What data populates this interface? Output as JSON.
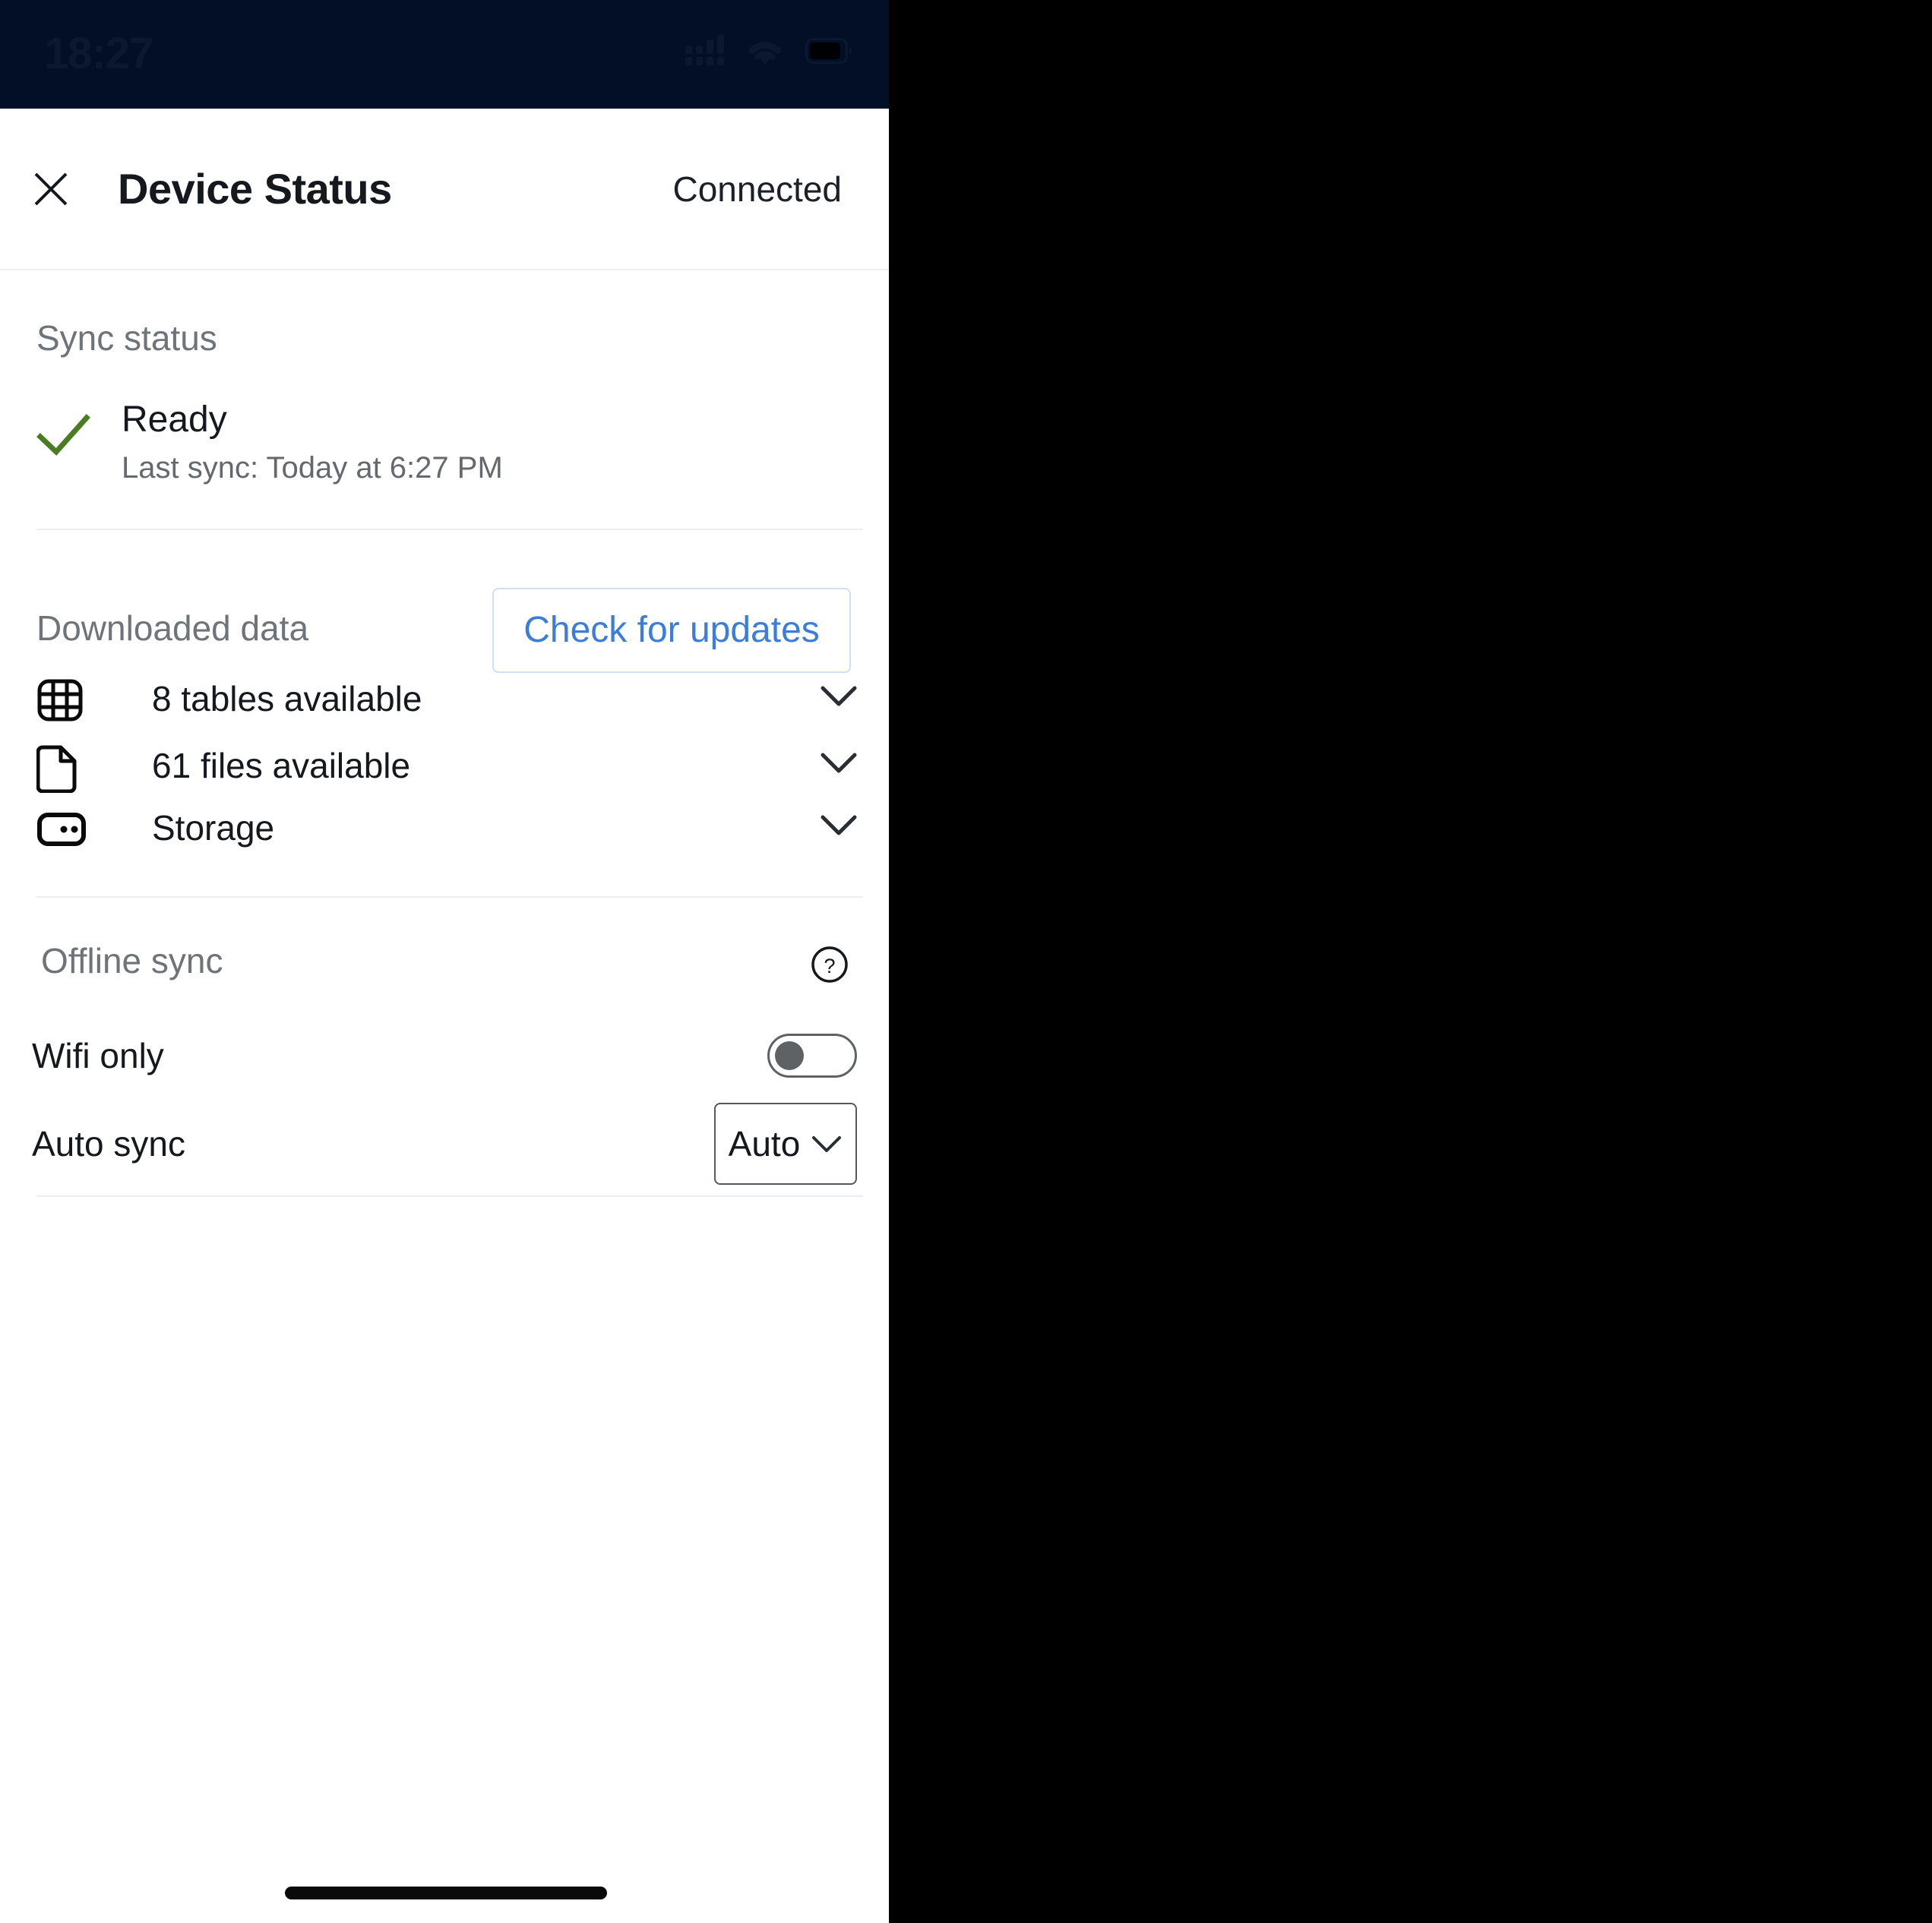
{
  "status_bar": {
    "time": "18:27",
    "icons": [
      "cellular-signal-icon",
      "wifi-icon",
      "battery-icon"
    ]
  },
  "header": {
    "close_icon": "close-icon",
    "title": "Device Status",
    "connection_status": "Connected"
  },
  "sync_status": {
    "section_label": "Sync status",
    "state_icon": "checkmark-icon",
    "state": "Ready",
    "last_sync": "Last sync: Today at 6:27 PM"
  },
  "downloaded_data": {
    "section_label": "Downloaded data",
    "check_updates_label": "Check for updates",
    "rows": [
      {
        "icon": "table-grid-icon",
        "label": "8 tables available",
        "chevron": "chevron-down-icon"
      },
      {
        "icon": "file-document-icon",
        "label": "61 files available",
        "chevron": "chevron-down-icon"
      },
      {
        "icon": "storage-drive-icon",
        "label": "Storage",
        "chevron": "chevron-down-icon"
      }
    ]
  },
  "offline_sync": {
    "section_label": "Offline sync",
    "help_icon": "help-circle-icon",
    "wifi_only": {
      "label": "Wifi only",
      "state": "off"
    },
    "auto_sync": {
      "label": "Auto sync",
      "value": "Auto",
      "chevron": "chevron-down-icon"
    }
  },
  "colors": {
    "status_bar_bg": "#030f26",
    "accent_blue": "#3b7dd8",
    "accent_blue_border": "#cfe0f5",
    "success_green": "#4a7d23",
    "text_primary": "#15181c",
    "text_muted": "#6f7478",
    "divider": "#eceef0"
  }
}
